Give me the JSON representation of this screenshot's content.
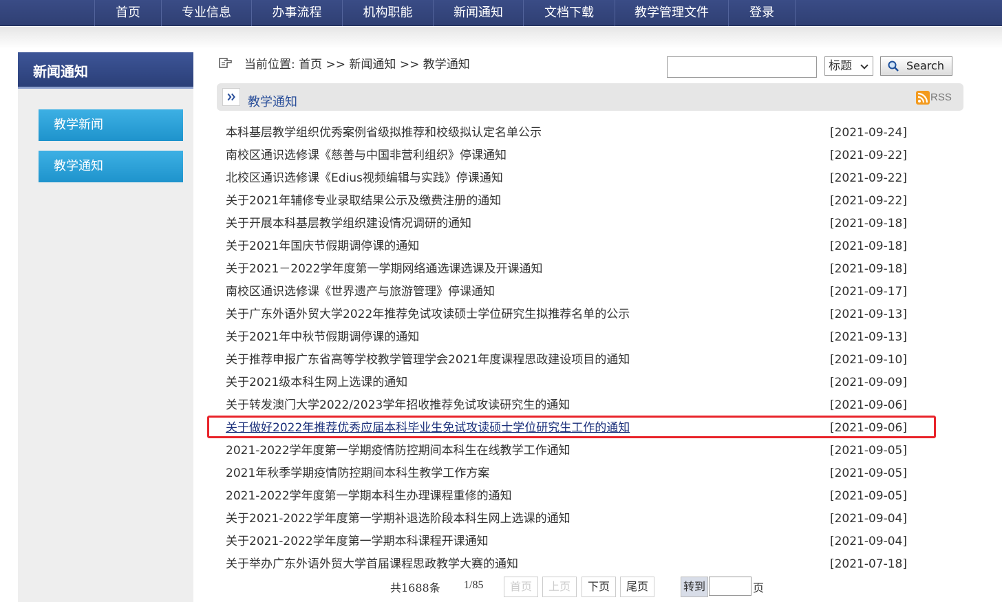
{
  "nav": {
    "items": [
      "首页",
      "专业信息",
      "办事流程",
      "机构职能",
      "新闻通知",
      "文档下载",
      "教学管理文件",
      "登录"
    ]
  },
  "sidebar": {
    "title": "新闻通知",
    "items": [
      "教学新闻",
      "教学通知"
    ]
  },
  "breadcrumb": {
    "text": "当前位置: 首页 >> 新闻通知 >> 教学通知"
  },
  "search": {
    "value": "",
    "field_select": "标题",
    "button_label": "Search"
  },
  "section": {
    "title": "教学通知",
    "rss_label": "RSS"
  },
  "articles": [
    {
      "title": "本科基层教学组织优秀案例省级拟推荐和校级拟认定名单公示",
      "date": "[2021-09-24]"
    },
    {
      "title": "南校区通识选修课《慈善与中国非营利组织》停课通知",
      "date": "[2021-09-22]"
    },
    {
      "title": "北校区通识选修课《Edius视频编辑与实践》停课通知",
      "date": "[2021-09-22]"
    },
    {
      "title": "关于2021年辅修专业录取结果公示及缴费注册的通知",
      "date": "[2021-09-22]"
    },
    {
      "title": "关于开展本科基层教学组织建设情况调研的通知",
      "date": "[2021-09-18]"
    },
    {
      "title": "关于2021年国庆节假期调停课的通知",
      "date": "[2021-09-18]"
    },
    {
      "title": "关于2021－2022学年度第一学期网络通选课选课及开课通知",
      "date": "[2021-09-18]"
    },
    {
      "title": "南校区通识选修课《世界遗产与旅游管理》停课通知",
      "date": "[2021-09-17]"
    },
    {
      "title": "关于广东外语外贸大学2022年推荐免试攻读硕士学位研究生拟推荐名单的公示",
      "date": "[2021-09-13]"
    },
    {
      "title": "关于2021年中秋节假期调停课的通知",
      "date": "[2021-09-13]"
    },
    {
      "title": "关于推荐申报广东省高等学校教学管理学会2021年度课程思政建设项目的通知",
      "date": "[2021-09-10]"
    },
    {
      "title": "关于2021级本科生网上选课的通知",
      "date": "[2021-09-09]"
    },
    {
      "title": "关于转发澳门大学2022/2023学年招收推荐免试攻读研究生的通知",
      "date": "[2021-09-06]"
    },
    {
      "title": "关于做好2022年推荐优秀应届本科毕业生免试攻读硕士学位研究生工作的通知",
      "date": "[2021-09-06]"
    },
    {
      "title": "2021-2022学年度第一学期疫情防控期间本科生在线教学工作通知",
      "date": "[2021-09-05]"
    },
    {
      "title": "2021年秋季学期疫情防控期间本科生教学工作方案",
      "date": "[2021-09-05]"
    },
    {
      "title": "2021-2022学年度第一学期本科生办理课程重修的通知",
      "date": "[2021-09-05]"
    },
    {
      "title": "关于2021-2022学年度第一学期补退选阶段本科生网上选课的通知",
      "date": "[2021-09-04]"
    },
    {
      "title": "关于2021-2022学年度第一学期本科课程开课通知",
      "date": "[2021-09-04]"
    },
    {
      "title": "关于举办广东外语外贸大学首届课程思政教学大赛的通知",
      "date": "[2021-07-18]"
    }
  ],
  "pager": {
    "total": "共1688条",
    "page": "1/85",
    "first": "首页",
    "prev": "上页",
    "next": "下页",
    "last": "尾页",
    "goto": "转到",
    "page_unit": "页",
    "goto_value": ""
  },
  "colors": {
    "nav_bg": "#2f3f73",
    "sidebar_button": "#1e93cc",
    "highlight_box": "#e8232a",
    "link_active": "#1a2f7a"
  }
}
